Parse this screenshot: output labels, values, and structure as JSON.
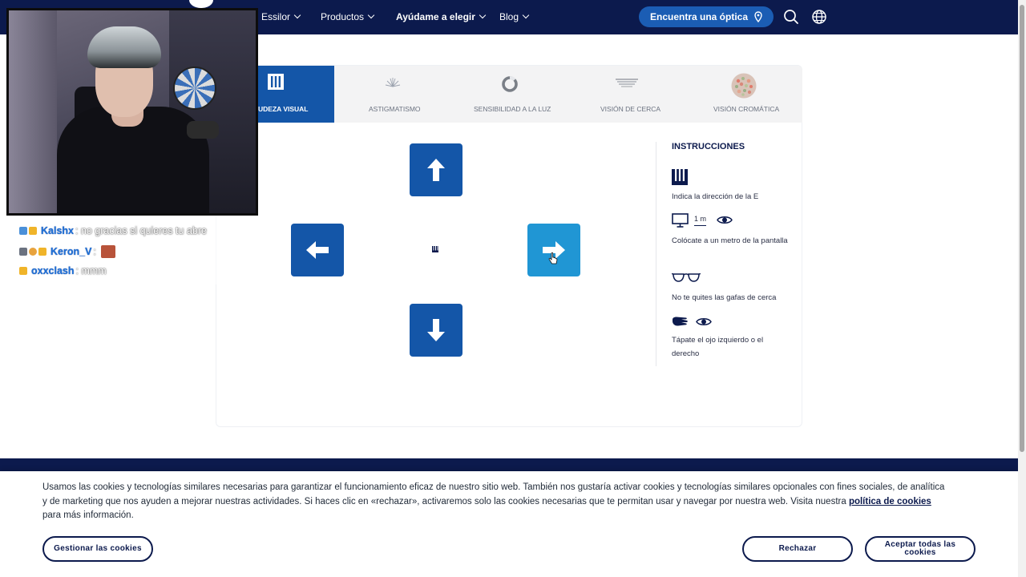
{
  "nav": {
    "items": [
      {
        "label": "Essilor",
        "bold": false
      },
      {
        "label": "Productos",
        "bold": false
      },
      {
        "label": "Ayúdame a elegir",
        "bold": true
      },
      {
        "label": "Blog",
        "bold": false
      }
    ],
    "cta_label": "Encuentra una óptica",
    "icons": [
      "location-pin-icon",
      "search-icon",
      "globe-icon"
    ]
  },
  "tabs": [
    {
      "label": "AGUDEZA VISUAL",
      "visible_label": "UDEZA VISUAL",
      "icon": "e-chart-icon",
      "active": true
    },
    {
      "label": "ASTIGMATISMO",
      "icon": "astigmatism-fan-icon",
      "active": false
    },
    {
      "label": "SENSIBILIDAD A LA LUZ",
      "icon": "light-ring-icon",
      "active": false
    },
    {
      "label": "VISIÓN DE CERCA",
      "icon": "near-lines-icon",
      "active": false
    },
    {
      "label": "VISIÓN CROMÁTICA",
      "icon": "color-plate-icon",
      "active": false
    }
  ],
  "test": {
    "arrows": [
      "arrow-up",
      "arrow-left",
      "arrow-right",
      "arrow-down"
    ],
    "hovered": "arrow-right"
  },
  "instructions": {
    "title": "INSTRUCCIONES",
    "step1": "Indica la dirección de la E",
    "distance": "1 m",
    "step2": "Colócate a un metro de la pantalla",
    "step3": "No te quites las gafas de cerca",
    "step4": "Tápate el ojo izquierdo o el derecho"
  },
  "chat": [
    {
      "user": "Kalshx",
      "message": ": no gracias si quieres tu abre"
    },
    {
      "user": "Keron_V",
      "message": ":"
    },
    {
      "user": "oxxclash",
      "message": ": mmm"
    }
  ],
  "cookie": {
    "text_before": "Usamos las cookies y tecnologías similares necesarias para garantizar el funcionamiento eficaz de nuestro sitio web. También nos gustaría activar cookies y tecnologías similares opcionales con fines sociales, de analítica y de marketing que nos ayuden a mejorar nuestras actividades. Si haces clic en «rechazar», activaremos solo las cookies necesarias que te permitan usar y navegar por nuestra web. Visita nuestra ",
    "link": "política de cookies",
    "text_after": " para más información.",
    "manage_label": "Gestionar las cookies",
    "reject_label": "Rechazar",
    "accept_label": "Aceptar todas las cookies"
  },
  "colors": {
    "navy": "#0c1a4d",
    "blue": "#1456a8",
    "hover_blue": "#2096d4"
  }
}
